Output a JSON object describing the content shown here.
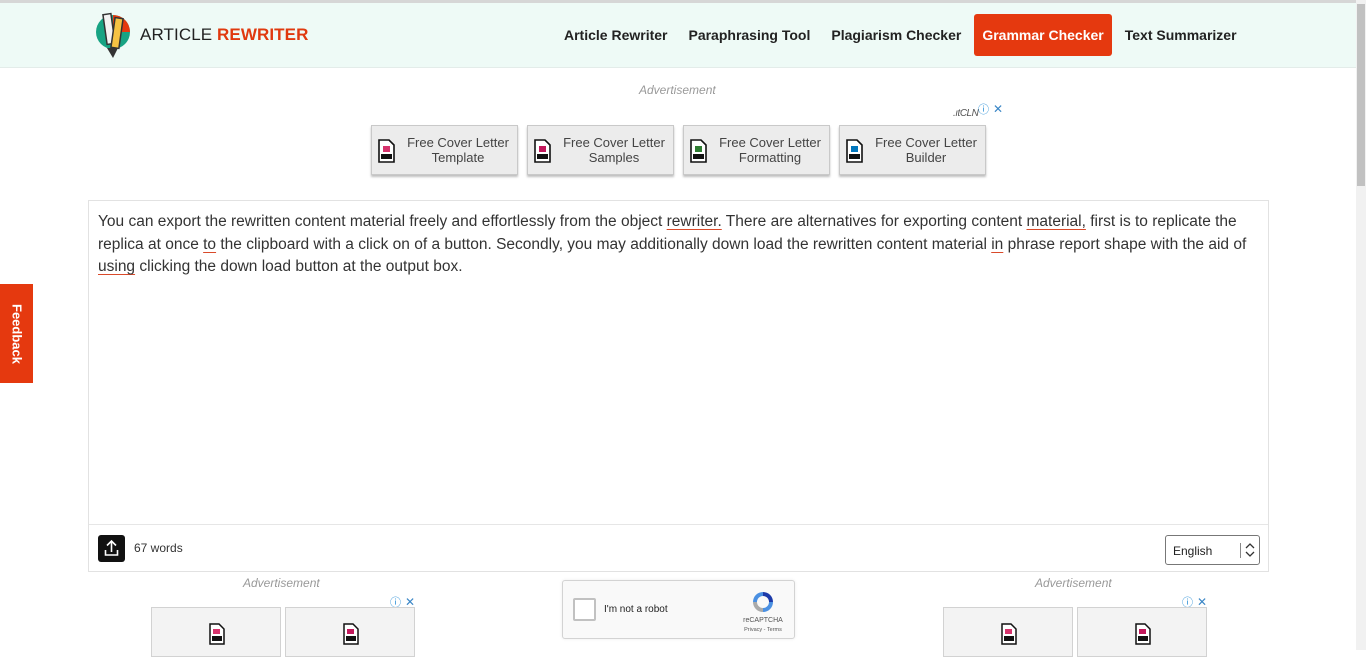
{
  "header": {
    "brand_part1": "ARTICLE ",
    "brand_part2": "REWRITER",
    "nav": [
      {
        "label": "Article Rewriter",
        "active": false
      },
      {
        "label": "Paraphrasing Tool",
        "active": false
      },
      {
        "label": "Plagiarism Checker",
        "active": false
      },
      {
        "label": "Grammar Checker",
        "active": true
      },
      {
        "label": "Text Summarizer",
        "active": false
      }
    ]
  },
  "top_ad": {
    "label": "Advertisement",
    "info_mark": "ⓘ",
    "close_mark": "✕",
    "cl_text": ".ıtCLN",
    "buttons": [
      {
        "line1": "Free Cover Letter",
        "line2": "Template",
        "icon_color": "#d6336c"
      },
      {
        "line1": "Free Cover Letter",
        "line2": "Samples",
        "icon_color": "#c2185b"
      },
      {
        "line1": "Free Cover Letter",
        "line2": "Formatting",
        "icon_color": "#2e7d32"
      },
      {
        "line1": "Free Cover Letter",
        "line2": "Builder",
        "icon_color": "#0277bd"
      }
    ]
  },
  "editor": {
    "text_segments": [
      {
        "text": "You can export the rewritten content material freely and effortlessly from the object ",
        "error": false
      },
      {
        "text": "rewriter.",
        "error": true
      },
      {
        "text": " There are alternatives for exporting content ",
        "error": false
      },
      {
        "text": "material,",
        "error": true
      },
      {
        "text": " first is to replicate the replica at once ",
        "error": false
      },
      {
        "text": "to",
        "error": true
      },
      {
        "text": " the clipboard with a click on of a button. Secondly, you may additionally down load the rewritten content material ",
        "error": false
      },
      {
        "text": "in",
        "error": true
      },
      {
        "text": " phrase report shape with the aid of ",
        "error": false
      },
      {
        "text": "using",
        "error": true
      },
      {
        "text": " clicking the down load button at the output box.",
        "error": false
      }
    ],
    "word_count": "67 words",
    "language": "English"
  },
  "feedback": {
    "label": "Feedback"
  },
  "bottom_ads": {
    "left_label": "Advertisement",
    "right_label": "Advertisement",
    "info_mark": "ⓘ",
    "close_mark": "✕"
  },
  "captcha": {
    "label": "I'm not a robot",
    "brand": "reCAPTCHA",
    "links": "Privacy - Terms"
  },
  "colors": {
    "accent": "#e5390f",
    "header_bg": "#eefaf6",
    "error_underline": "#d94a2a"
  }
}
